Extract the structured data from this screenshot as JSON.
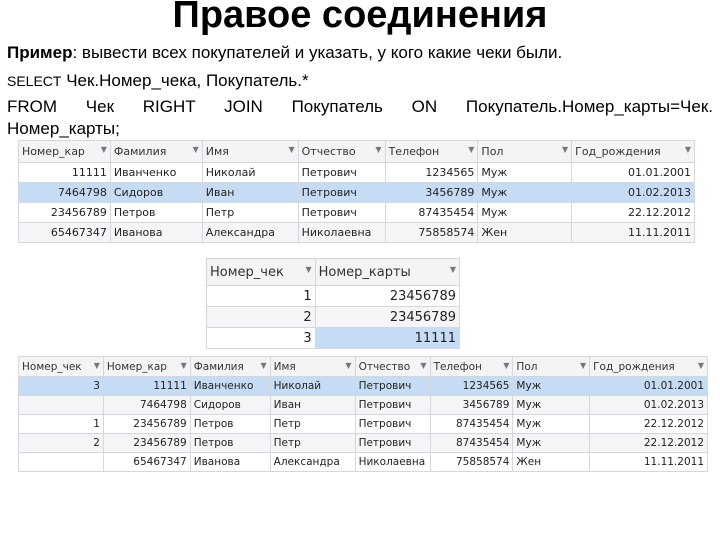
{
  "title": "Правое соединения",
  "example_label": "Пример",
  "example_text": ": вывести всех покупателей и указать, у кого какие чеки были.",
  "sql_line1_kw": "SELECT",
  "sql_line1_rest": " Чек.Номер_чека, Покупатель.*",
  "sql_line2": "FROM Чек RIGHT JOIN Покупатель ON Покупатель.Номер_карты=Чек. Номер_карты;",
  "highlight_color": "#c6dcf4",
  "customers": {
    "headers": [
      "Номер_кар",
      "Фамилия",
      "Имя",
      "Отчество",
      "Телефон",
      "Пол",
      "Год_рождения"
    ],
    "rows": [
      [
        "11111",
        "Иванченко",
        "Николай",
        "Петрович",
        "1234565",
        "Муж",
        "01.01.2001"
      ],
      [
        "7464798",
        "Сидоров",
        "Иван",
        "Петрович",
        "3456789",
        "Муж",
        "01.02.2013"
      ],
      [
        "23456789",
        "Петров",
        "Петр",
        "Петрович",
        "87435454",
        "Муж",
        "22.12.2012"
      ],
      [
        "65467347",
        "Иванова",
        "Александра",
        "Николаевна",
        "75858574",
        "Жен",
        "11.11.2011"
      ]
    ],
    "selected_row": 1
  },
  "checks": {
    "headers": [
      "Номер_чек",
      "Номер_карты"
    ],
    "rows": [
      [
        "1",
        "23456789"
      ],
      [
        "2",
        "23456789"
      ],
      [
        "3",
        "11111"
      ]
    ],
    "selected_cell": [
      2,
      1
    ]
  },
  "result": {
    "headers": [
      "Номер_чек",
      "Номер_кар",
      "Фамилия",
      "Имя",
      "Отчество",
      "Телефон",
      "Пол",
      "Год_рождения"
    ],
    "rows": [
      [
        "3",
        "11111",
        "Иванченко",
        "Николай",
        "Петрович",
        "1234565",
        "Муж",
        "01.01.2001"
      ],
      [
        "",
        "7464798",
        "Сидоров",
        "Иван",
        "Петрович",
        "3456789",
        "Муж",
        "01.02.2013"
      ],
      [
        "1",
        "23456789",
        "Петров",
        "Петр",
        "Петрович",
        "87435454",
        "Муж",
        "22.12.2012"
      ],
      [
        "2",
        "23456789",
        "Петров",
        "Петр",
        "Петрович",
        "87435454",
        "Муж",
        "22.12.2012"
      ],
      [
        "",
        "65467347",
        "Иванова",
        "Александра",
        "Николаевна",
        "75858574",
        "Жен",
        "11.11.2011"
      ]
    ],
    "selected_row": 0
  }
}
